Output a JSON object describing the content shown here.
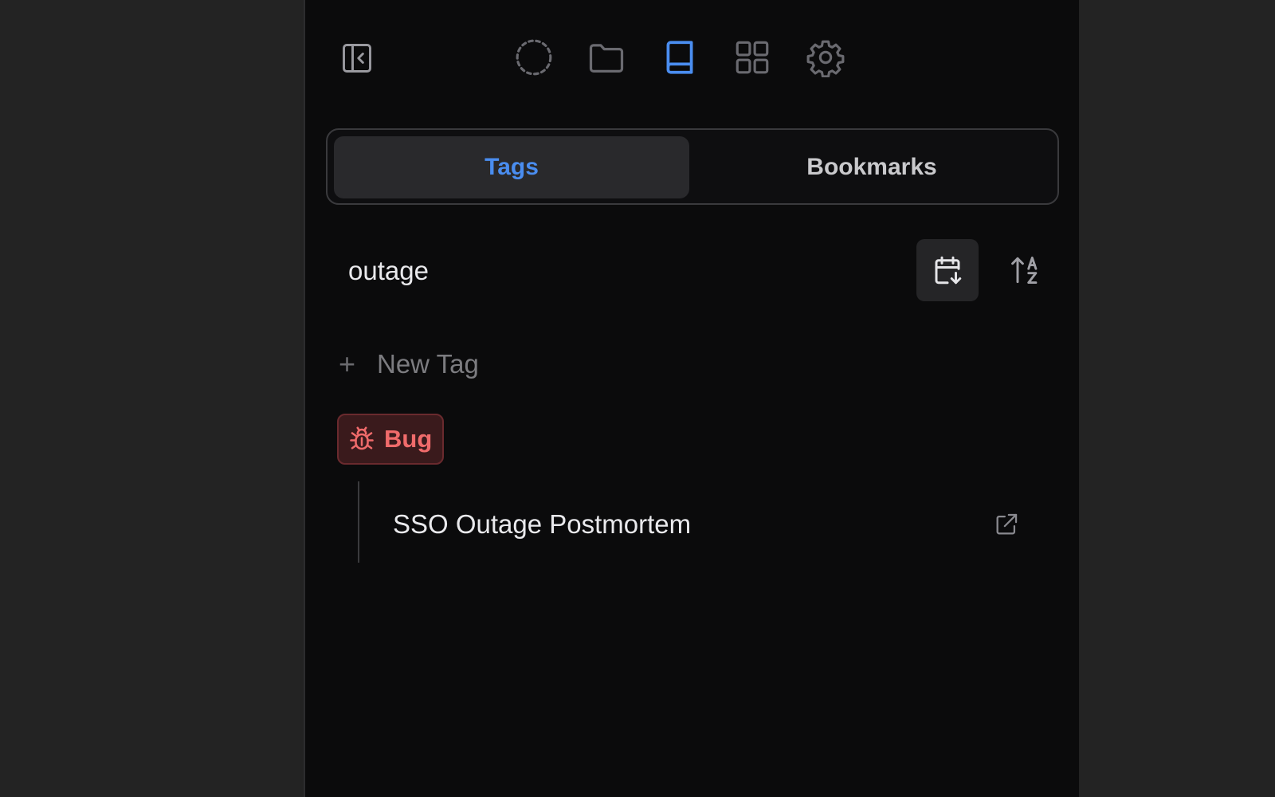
{
  "toolbar": {
    "icons": [
      "sidebar-collapse-icon",
      "loading-circle-icon",
      "folder-icon",
      "book-icon",
      "grid-icon",
      "gear-icon"
    ],
    "active_icon": "book-icon",
    "accent_color": "#4a8df0"
  },
  "tabs": {
    "tags_label": "Tags",
    "bookmarks_label": "Bookmarks",
    "active": "Tags"
  },
  "search": {
    "value": "outage",
    "placeholder": ""
  },
  "sort": {
    "date_icon": "calendar-sort-icon",
    "alpha_icon": "sort-alpha-icon"
  },
  "new_tag": {
    "plus": "+",
    "label": "New Tag"
  },
  "tags": [
    {
      "label": "Bug",
      "icon": "bug-icon",
      "color": "#f06b6b",
      "bookmarks": [
        {
          "title": "SSO Outage Postmortem",
          "icon": "external-link-icon"
        }
      ]
    }
  ]
}
